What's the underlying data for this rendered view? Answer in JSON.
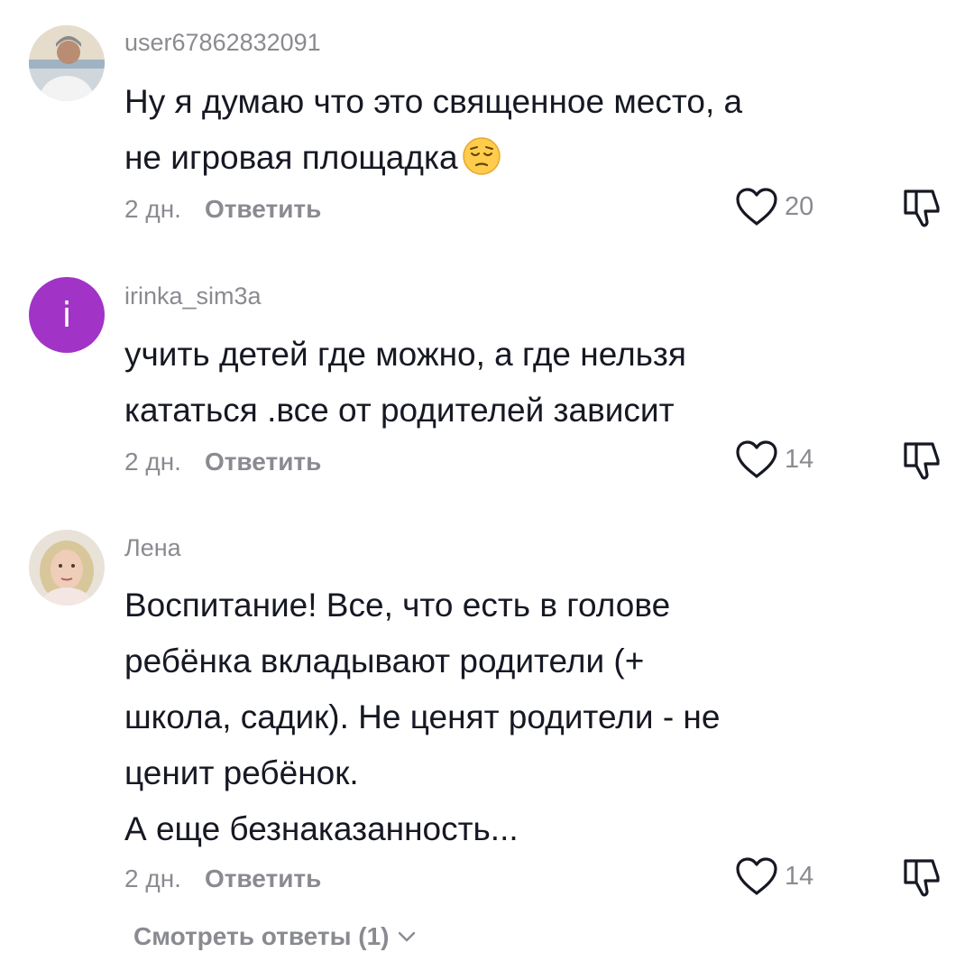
{
  "comments": [
    {
      "username": "user67862832091",
      "avatar_icon": "user-photo-avatar",
      "text_lines": [
        "Ну я думаю что это священное место, а",
        "не игровая площадка"
      ],
      "emoji": "pensive-face-emoji",
      "time": "2 дн.",
      "reply_label": "Ответить",
      "likes": "20"
    },
    {
      "username": "irinka_sim3a",
      "avatar_letter": "i",
      "avatar_color": "#a133c7",
      "text_lines": [
        "учить детей где можно, а где нельзя",
        "кататься .все от родителей зависит"
      ],
      "time": "2 дн.",
      "reply_label": "Ответить",
      "likes": "14"
    },
    {
      "username": "Лена",
      "avatar_icon": "user-photo-avatar",
      "text_lines": [
        "Воспитание! Все, что есть в голове",
        "ребёнка вкладывают родители (+",
        "школа, садик). Не ценят родители - не",
        "ценит ребёнок.",
        "А еще безнаказанность..."
      ],
      "time": "2 дн.",
      "reply_label": "Ответить",
      "likes": "14"
    }
  ],
  "view_replies_label": "Смотреть ответы (1)",
  "colors": {
    "text": "#161823",
    "secondary": "#8a8b91",
    "accent_avatar": "#a133c7"
  },
  "icons": [
    "heart-outline-icon",
    "dislike-icon",
    "chevron-down-icon"
  ]
}
